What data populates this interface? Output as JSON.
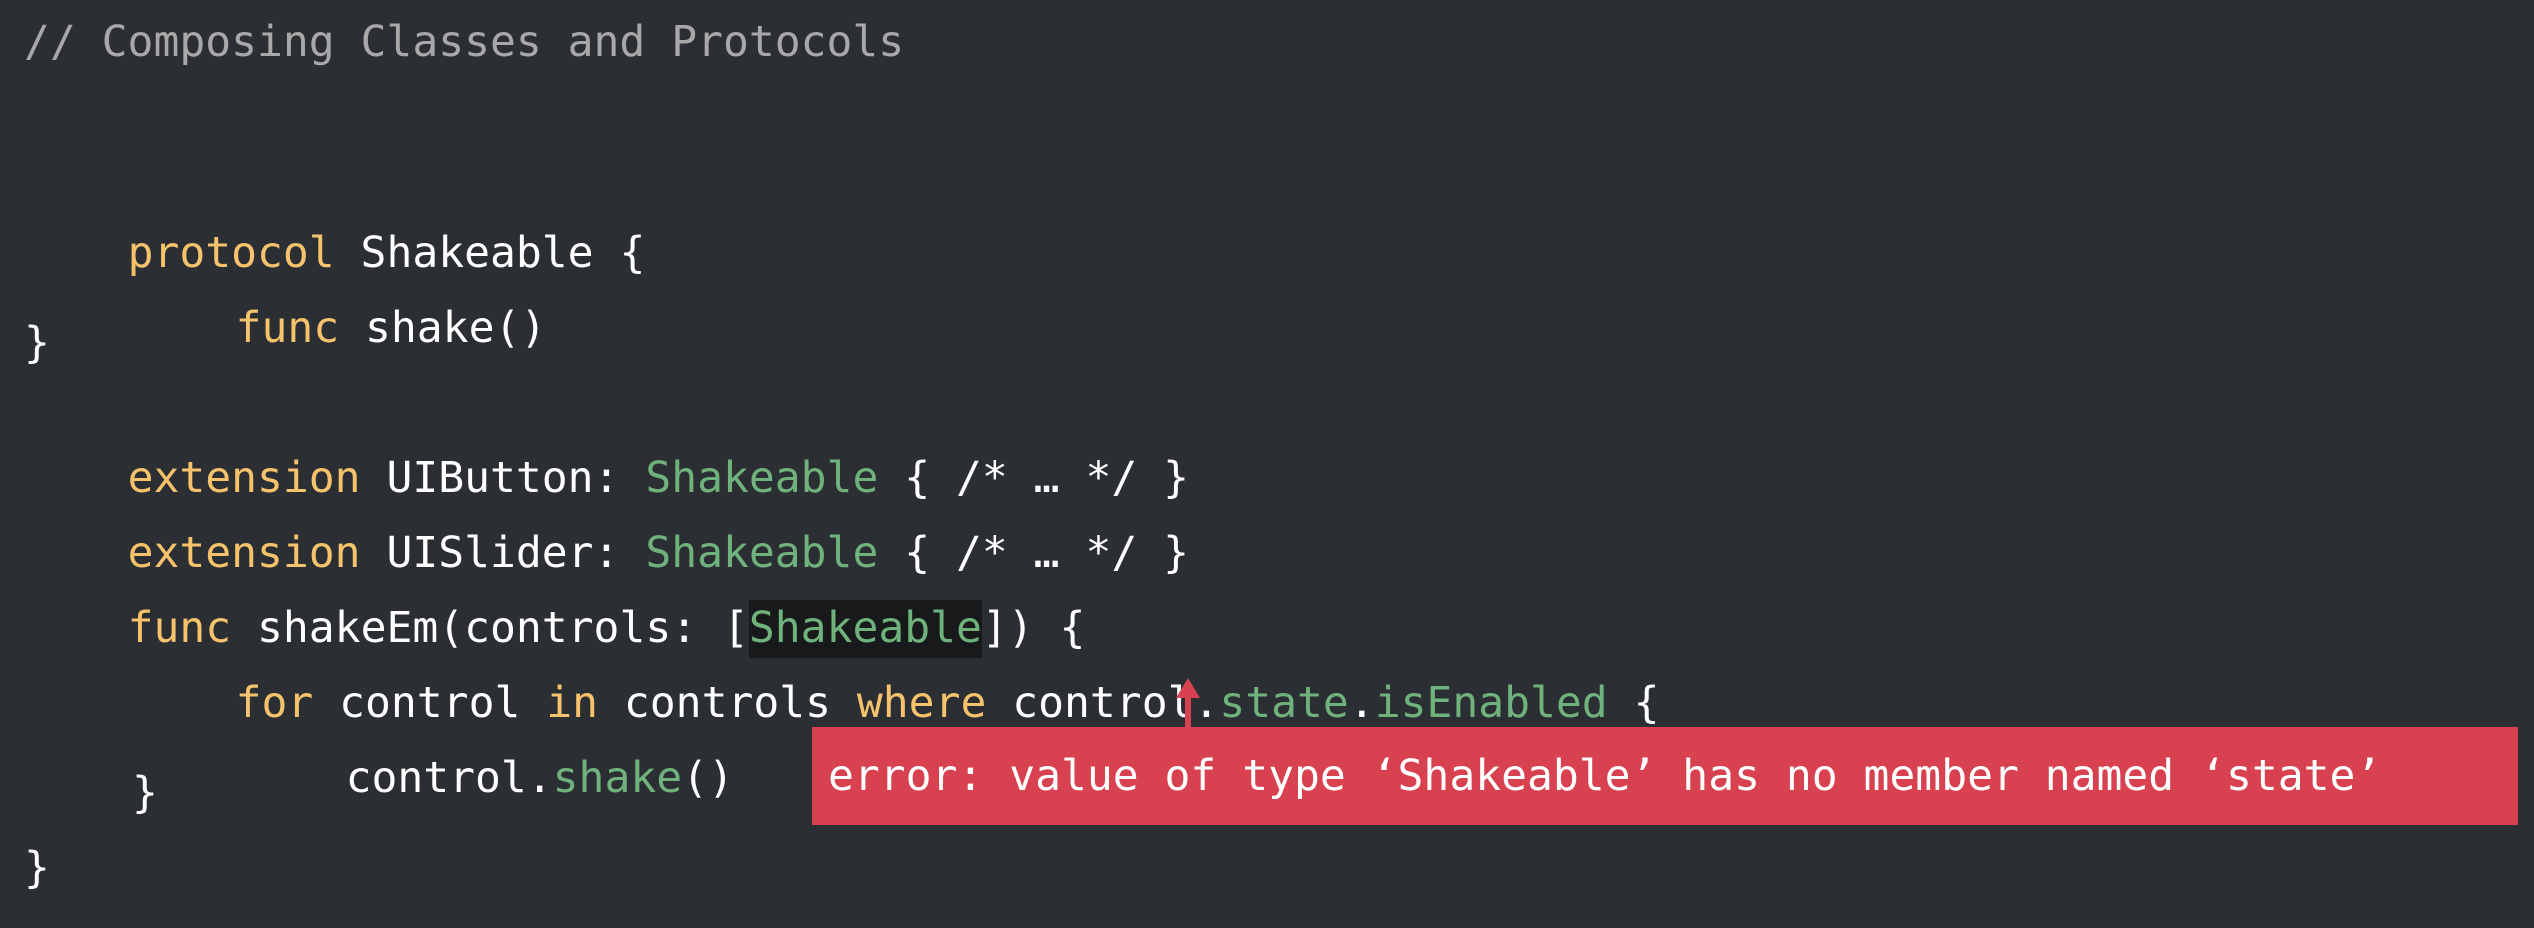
{
  "code": {
    "comment": "// Composing Classes and Protocols",
    "line_protocol": {
      "kw": "protocol",
      "name": " Shakeable {"
    },
    "line_func_decl": {
      "kw": "func",
      "rest": " shake()"
    },
    "line_close1": "}",
    "line_ext_button": {
      "kw": "extension",
      "name": " UIButton: ",
      "type": "Shakeable",
      "rest": " { /* … */ }"
    },
    "line_ext_slider": {
      "kw": "extension",
      "name": " UISlider: ",
      "type": "Shakeable",
      "rest": " { /* … */ }"
    },
    "line_func_shake": {
      "kw": "func",
      "rest1": " shakeEm(controls: [",
      "type": "Shakeable",
      "rest2": "]) {"
    },
    "line_for": {
      "kw_for": "for",
      "t1": " control ",
      "kw_in": "in",
      "t2": " controls ",
      "kw_where": "where",
      "t3": " control.",
      "member1": "state",
      "dot": ".",
      "member2": "isEnabled",
      "t4": " {"
    },
    "line_call": {
      "t1": "control.",
      "member": "shake",
      "t2": "()"
    },
    "line_close2": "}",
    "line_close3": "}"
  },
  "error": {
    "message": "error: value of type ‘Shakeable’ has no member named ‘state’"
  },
  "colors": {
    "background": "#2b2f33",
    "keyword": "#f6c26b",
    "type": "#6fb27c",
    "comment": "#a8a8a8",
    "error": "#d8414f"
  }
}
